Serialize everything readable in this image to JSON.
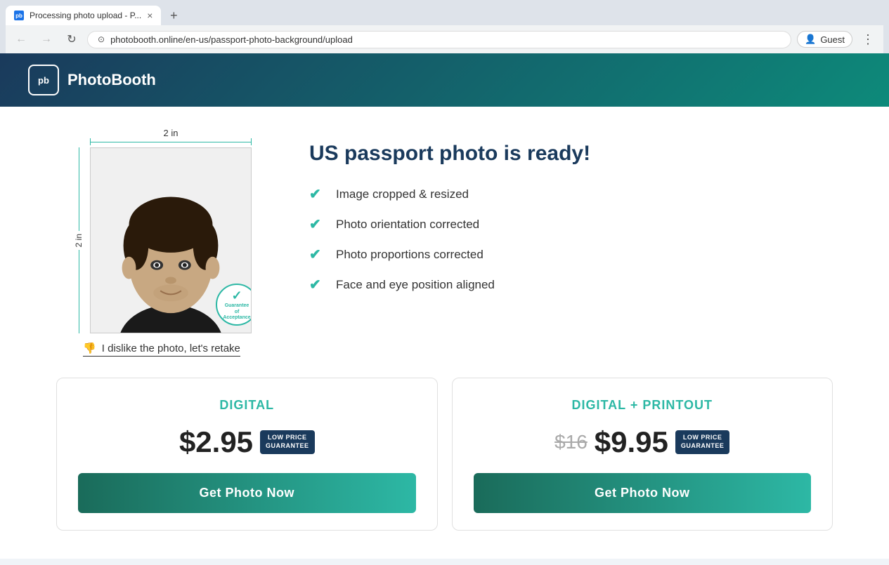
{
  "browser": {
    "tab": {
      "favicon": "pb",
      "title": "Processing photo upload - P...",
      "close_icon": "×"
    },
    "new_tab_icon": "+",
    "nav": {
      "back_icon": "←",
      "forward_icon": "→",
      "refresh_icon": "↻",
      "address_lock_icon": "⊙",
      "address": "photobooth.online/en-us/passport-photo-background/upload",
      "menu_icon": "⋮",
      "profile_label": "Guest"
    }
  },
  "header": {
    "logo_text": "pb",
    "brand_name": "PhotoBooth"
  },
  "photo": {
    "dimension_top": "2 in",
    "dimension_side": "2 in",
    "guarantee_line1": "Guarantee",
    "guarantee_line2": "of",
    "guarantee_line3": "Acceptance",
    "retake_icon": "👎",
    "retake_text": "I dislike the photo, let's retake"
  },
  "info": {
    "title": "US passport photo is ready!",
    "features": [
      "Image cropped & resized",
      "Photo orientation corrected",
      "Photo proportions corrected",
      "Face and eye position aligned"
    ]
  },
  "pricing": {
    "cards": [
      {
        "plan": "DIGITAL",
        "price": "$2.95",
        "old_price": null,
        "badge_line1": "LOW PRICE",
        "badge_line2": "GUARANTEE",
        "btn_label": "Get Photo Now"
      },
      {
        "plan": "DIGITAL + PRINTOUT",
        "price": "$9.95",
        "old_price": "$16",
        "badge_line1": "LOW PRICE",
        "badge_line2": "GUARANTEE",
        "btn_label": "Get Photo Now"
      }
    ]
  },
  "colors": {
    "teal": "#2db8a5",
    "navy": "#1a3a5c",
    "check": "#2db8a5"
  }
}
